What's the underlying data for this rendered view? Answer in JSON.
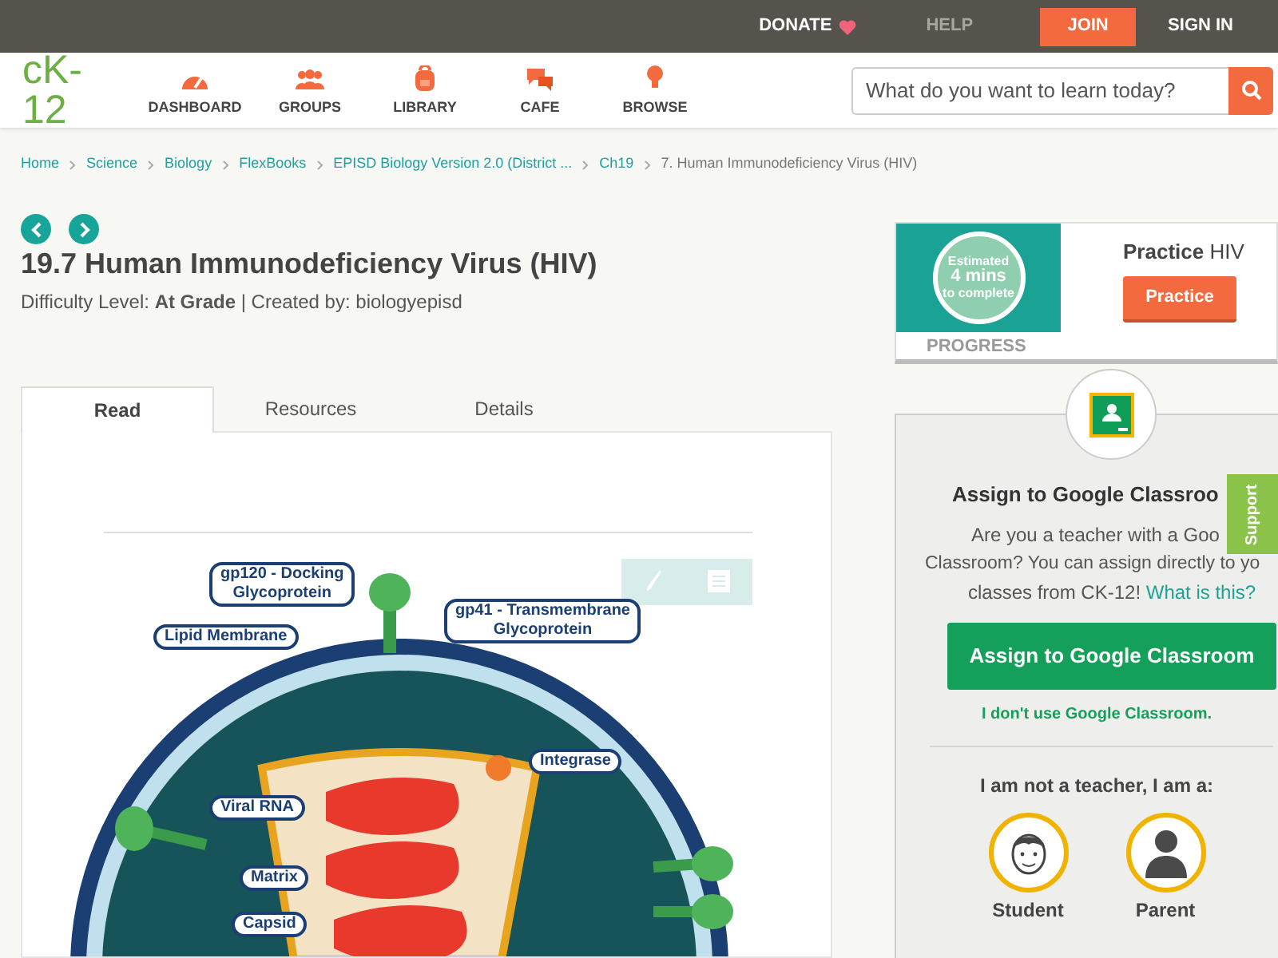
{
  "top_bar": {
    "links": [
      {
        "label": "DONATE",
        "kind": "donate"
      },
      {
        "label": "HELP",
        "kind": "muted"
      },
      {
        "label": "JOIN",
        "kind": "primary"
      },
      {
        "label": "SIGN IN",
        "kind": "plain"
      }
    ]
  },
  "nav": {
    "logo": "cK-12",
    "items": [
      {
        "label": "DASHBOARD"
      },
      {
        "label": "GROUPS"
      },
      {
        "label": "LIBRARY"
      },
      {
        "label": "CAFE"
      },
      {
        "label": "BROWSE"
      }
    ],
    "search": {
      "placeholder": "What do you want to learn today?"
    }
  },
  "breadcrumb": [
    {
      "label": "Home",
      "current": false
    },
    {
      "label": "Science",
      "current": false
    },
    {
      "label": "Biology",
      "current": false
    },
    {
      "label": "FlexBooks",
      "current": false
    },
    {
      "label": "EPISD Biology Version 2.0 (District ...",
      "current": false
    },
    {
      "label": "Ch19",
      "current": false
    },
    {
      "label": "7. Human Immunodeficiency Virus (HIV)",
      "current": true
    }
  ],
  "title": "19.7 Human Immunodeficiency Virus (HIV)",
  "meta": "Difficulty Level: **At Grade** | Created by: biologyepisd",
  "tabs": [
    {
      "label": "Read",
      "selected": true
    },
    {
      "label": "Resources",
      "selected": false
    },
    {
      "label": "Details",
      "selected": false
    }
  ],
  "diagram": {
    "labels": [
      "gp120 - Docking\nGlycoprotein",
      "gp41 - Transmembrane\nGlycoprotein",
      "Lipid Membrane",
      "Integrase",
      "Viral RNA",
      "Matrix",
      "Capsid"
    ]
  },
  "practice": {
    "progress_text": [
      "Estimated",
      "4 mins",
      "to complete"
    ],
    "progress_label": "PROGRESS",
    "title": "**Practice** HIV",
    "button": "Practice"
  },
  "classroom": {
    "title": "Assign to Google Classroo",
    "lines": [
      "Are you a teacher with a Goo",
      "Classroom? You can assign directly to yo"
    ],
    "last_line": "classes from CK-12!",
    "link": "What is this?",
    "button": "Assign to Google Classroom",
    "skip_link": "I don't use Google Classroom.",
    "not_teacher": "I am not a teacher, I am a:",
    "roles": [
      "Student",
      "Parent"
    ]
  },
  "support_tab": "Support"
}
